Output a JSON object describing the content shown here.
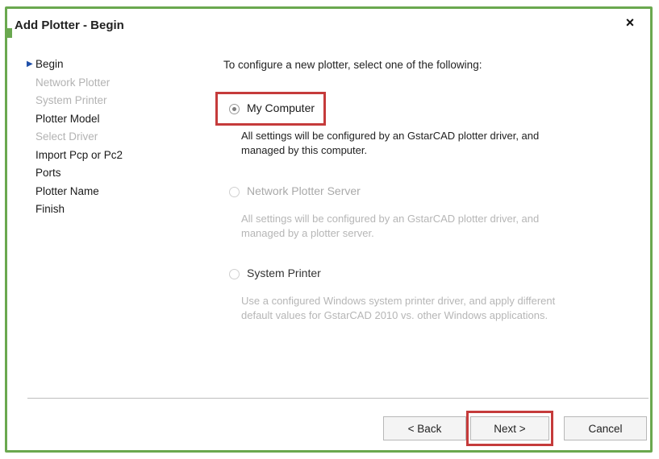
{
  "window": {
    "title": "Add Plotter - Begin",
    "close_glyph": "×"
  },
  "steps": [
    {
      "label": "Begin",
      "state": "current",
      "marker": "▶"
    },
    {
      "label": "Network Plotter",
      "state": "disabled"
    },
    {
      "label": "System Printer",
      "state": "disabled"
    },
    {
      "label": "Plotter Model",
      "state": "enabled"
    },
    {
      "label": "Select Driver",
      "state": "disabled"
    },
    {
      "label": "Import Pcp or Pc2",
      "state": "enabled"
    },
    {
      "label": "Ports",
      "state": "enabled"
    },
    {
      "label": "Plotter Name",
      "state": "enabled"
    },
    {
      "label": "Finish",
      "state": "enabled"
    }
  ],
  "main": {
    "instruction": "To configure a new plotter, select one of the following:",
    "options": [
      {
        "label": "My Computer",
        "selected": true,
        "enabled": true,
        "description": "All settings will be configured by an GstarCAD plotter driver, and managed by this computer."
      },
      {
        "label": "Network Plotter Server",
        "selected": false,
        "enabled": false,
        "description": "All settings will be configured by an GstarCAD plotter driver, and managed by a plotter server."
      },
      {
        "label": "System Printer",
        "selected": false,
        "enabled": true,
        "description": "Use a configured Windows system printer driver, and apply different default values for GstarCAD 2010 vs. other Windows applications."
      }
    ]
  },
  "buttons": {
    "back": "< Back",
    "next": "Next >",
    "cancel": "Cancel"
  },
  "colors": {
    "window_border": "#6aa84f",
    "highlight": "#c53b3b",
    "disabled_text": "#b3b3b3"
  }
}
